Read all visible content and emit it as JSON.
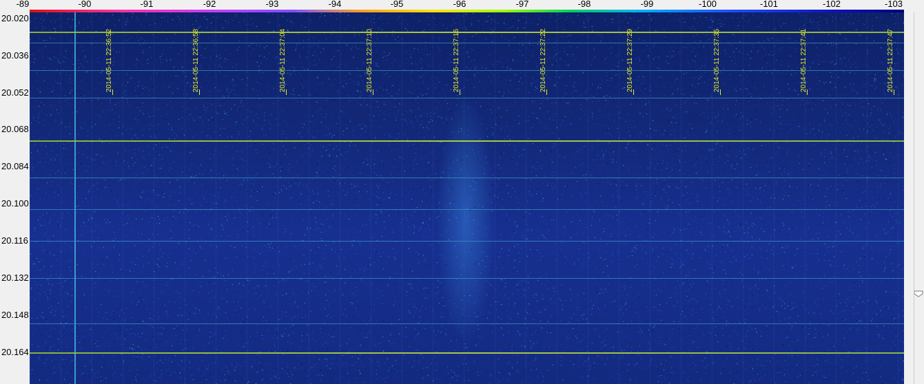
{
  "top_scale": {
    "ticks": [
      "-89",
      "-90",
      "-91",
      "-92",
      "-93",
      "-94",
      "-95",
      "-96",
      "-97",
      "-98",
      "-99",
      "-100",
      "-101",
      "-102",
      "-103"
    ]
  },
  "left_scale": {
    "ticks": [
      "20.020",
      "20.036",
      "20.052",
      "20.068",
      "20.084",
      "20.100",
      "20.116",
      "20.132",
      "20.148",
      "20.164"
    ]
  },
  "timestamps": [
    "2014-05-11 22:36:52",
    "2014-05-11 22:36:58",
    "2014-05-11 22:37:04",
    "2014-05-11 22:37:10",
    "2014-05-11 22:37:16",
    "2014-05-11 22:37:22",
    "2014-05-11 22:37:29",
    "2014-05-11 22:37:35",
    "2014-05-11 22:37:41",
    "2014-05-11 22:37:47"
  ],
  "colors": {
    "waterfall_bg": "#13297a",
    "marker_text": "#e8ee20",
    "signal_line": "#c4e838"
  }
}
